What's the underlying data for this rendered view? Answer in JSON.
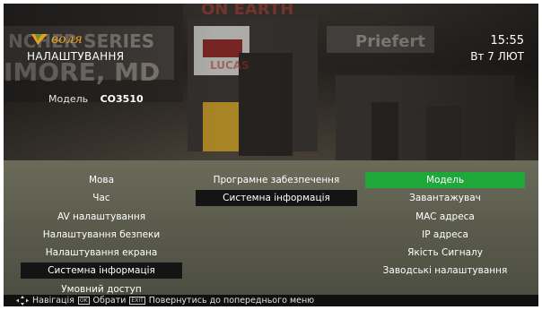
{
  "header": {
    "logo_text": "воля",
    "title": "НАЛАШТУВАННЯ",
    "time": "15:55",
    "date": "Вт 7 ЛЮТ"
  },
  "model": {
    "label": "Модель",
    "value": "CO3510"
  },
  "menu": {
    "categories": [
      "Мова",
      "Час",
      "AV налаштування",
      "Налаштування безпеки",
      "Налаштування екрана",
      "Системна інформація",
      "Умовний доступ"
    ],
    "submenu": [
      "Програмне забезпечення",
      "Системна інформація"
    ],
    "details": [
      "Модель",
      "Завантажувач",
      "MAC адреса",
      "IP адреса",
      "Якість Сигналу",
      "Заводські налаштування"
    ]
  },
  "footer": {
    "nav_label": "Навігація",
    "ok_key": "OK",
    "select_label": "Обрати",
    "back_key": "EXIT",
    "back_label": "Повернутись до попереднього меню"
  },
  "colors": {
    "highlight": "#1fa83a",
    "panel": "#5a5b4c",
    "dark_item": "#141414",
    "logo": "#e8a020"
  },
  "icons": [
    "logo-v-icon",
    "dpad-icon",
    "ok-key-icon",
    "exit-key-icon"
  ]
}
